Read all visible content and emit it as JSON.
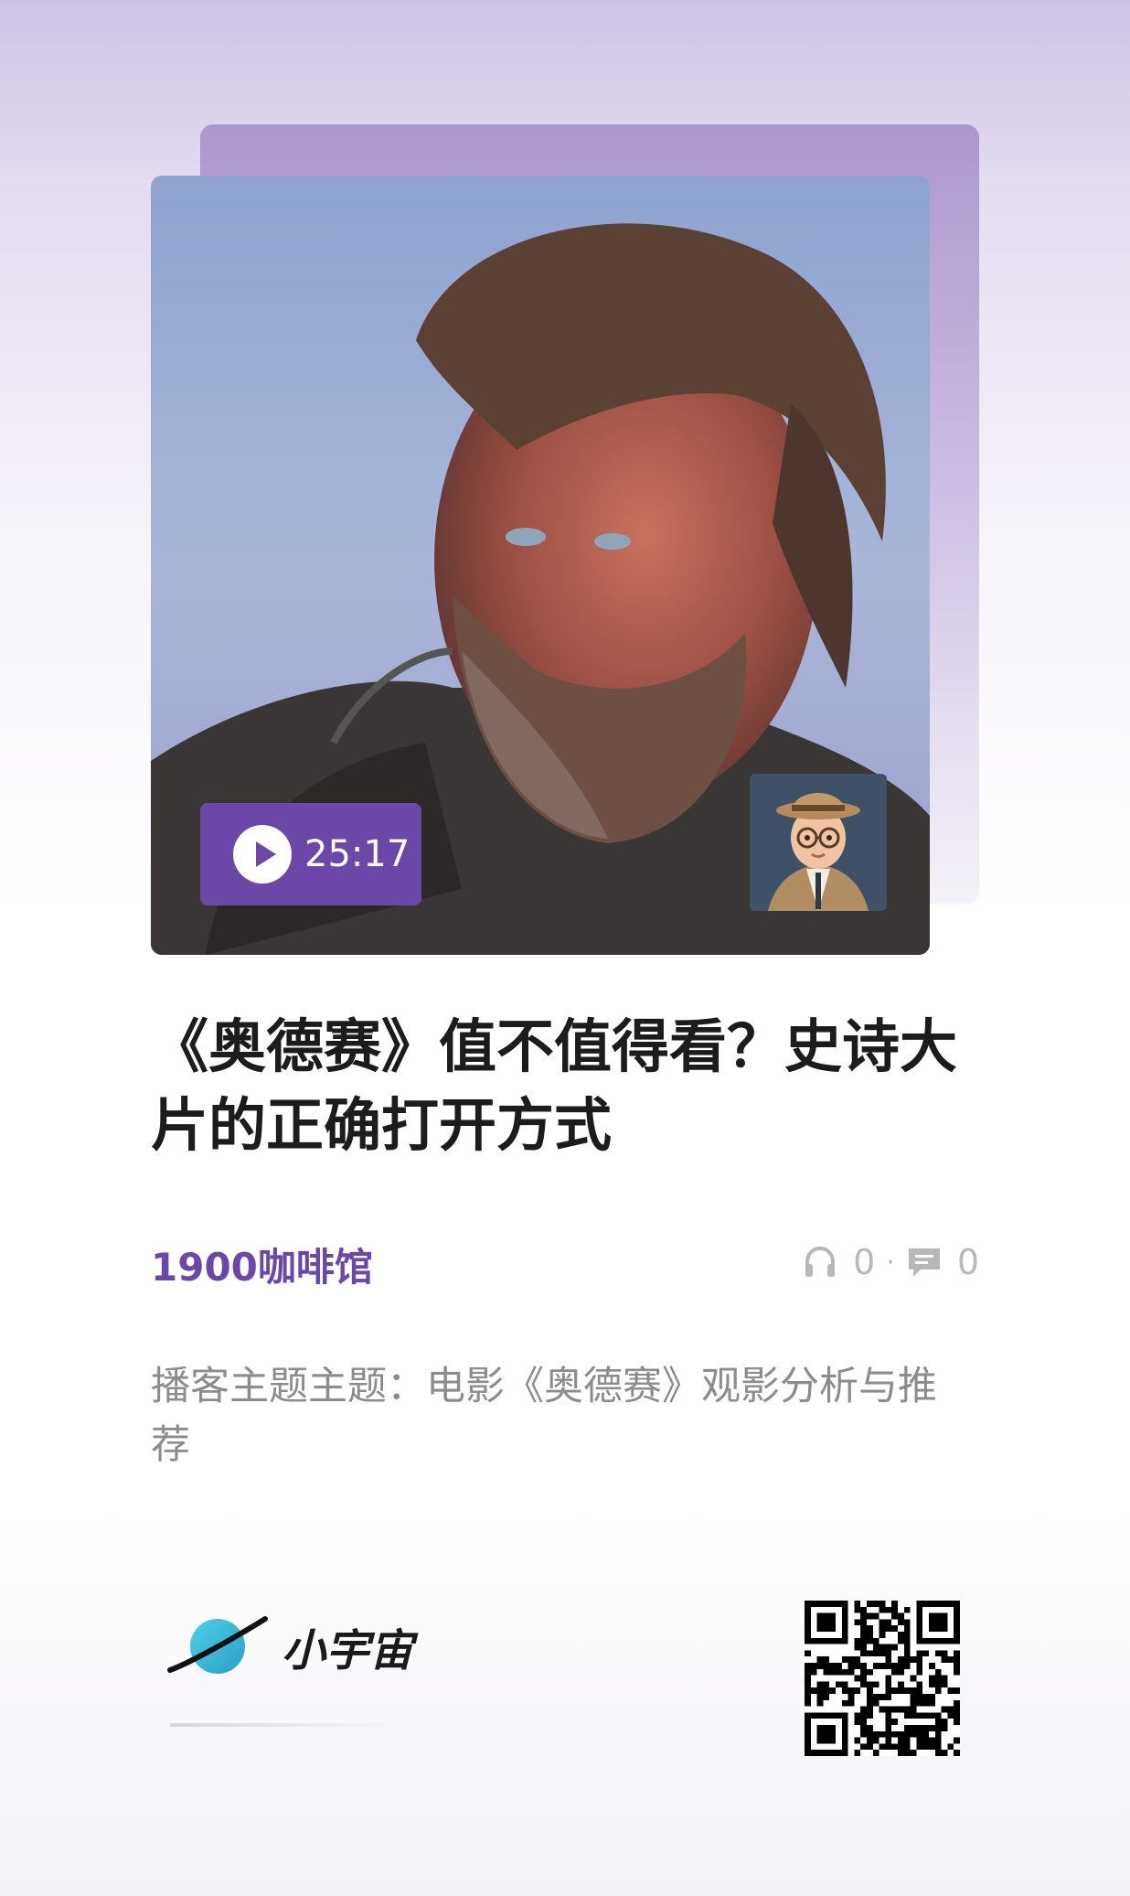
{
  "episode": {
    "duration": "25:17",
    "title": "《奥德赛》值不值得看？史诗大片的正确打开方式",
    "podcast_name": "1900咖啡馆",
    "listen_count": "0",
    "comment_count": "0",
    "description": "播客主题主题：电影《奥德赛》观影分析与推荐"
  },
  "stats": {
    "separator": "·"
  },
  "brand": {
    "name": "小宇宙"
  },
  "icons": {
    "play": "play-icon",
    "headphones": "headphones-icon",
    "comment": "comment-icon",
    "logo": "planet-logo-icon",
    "qr": "qr-code"
  },
  "colors": {
    "accent": "#6b48a8",
    "muted": "#b8b8b8"
  }
}
